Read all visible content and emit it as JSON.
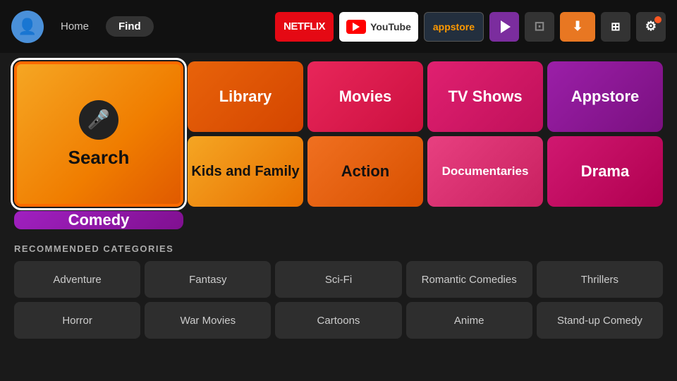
{
  "topbar": {
    "avatar_icon": "👤",
    "home_label": "Home",
    "find_label": "Find",
    "apps": [
      {
        "name": "netflix",
        "label": "NETFLIX"
      },
      {
        "name": "youtube",
        "label": "YouTube"
      },
      {
        "name": "appstore",
        "label": "appstore"
      },
      {
        "name": "primevideo",
        "label": "▶"
      },
      {
        "name": "screen",
        "label": "⊡"
      },
      {
        "name": "downloader",
        "label": "⬇"
      },
      {
        "name": "qr",
        "label": "⊞"
      },
      {
        "name": "gear",
        "label": "⚙"
      }
    ]
  },
  "grid": {
    "search_label": "Search",
    "library_label": "Library",
    "movies_label": "Movies",
    "tvshows_label": "TV Shows",
    "appstore_label": "Appstore",
    "kidsandfamily_label": "Kids and Family",
    "action_label": "Action",
    "documentaries_label": "Documentaries",
    "drama_label": "Drama",
    "comedy_label": "Comedy"
  },
  "recommended": {
    "title": "RECOMMENDED CATEGORIES",
    "items": [
      "Adventure",
      "Fantasy",
      "Sci-Fi",
      "Romantic Comedies",
      "Thrillers",
      "Horror",
      "War Movies",
      "Cartoons",
      "Anime",
      "Stand-up Comedy"
    ]
  }
}
